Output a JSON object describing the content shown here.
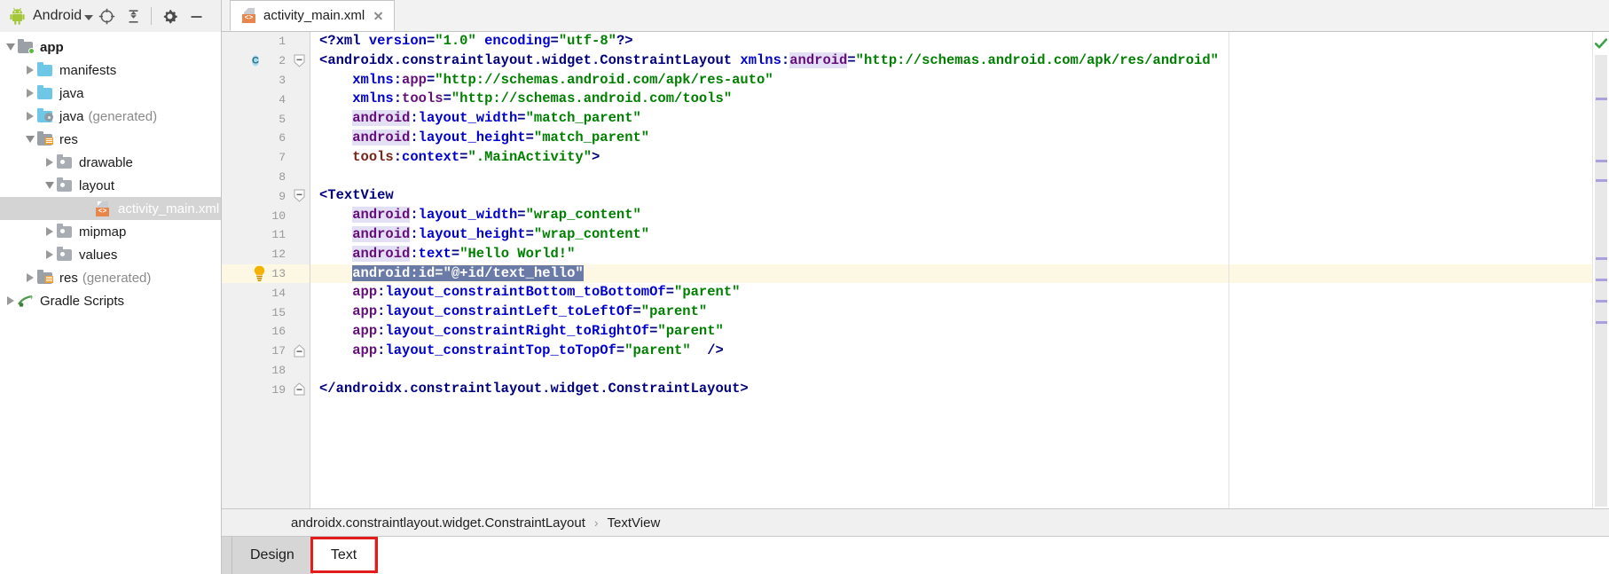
{
  "window": {
    "project_panel_title": "Android",
    "toolbar_icons": [
      "android-logo",
      "dropdown-caret",
      "locate-target-icon",
      "collapse-all-icon",
      "settings-gear-icon",
      "minimize-icon"
    ]
  },
  "editor_tab": {
    "filename": "activity_main.xml",
    "icon": "xml-file-icon",
    "badge_text": "<>",
    "close_icon": "close-icon"
  },
  "project_tree": [
    {
      "label": "app",
      "suffix": "",
      "indent": 0,
      "expanded": true,
      "icon": "module-folder",
      "bold": true,
      "selected": false
    },
    {
      "label": "manifests",
      "suffix": "",
      "indent": 1,
      "expanded": false,
      "icon": "blue-folder",
      "bold": false,
      "selected": false
    },
    {
      "label": "java",
      "suffix": "",
      "indent": 1,
      "expanded": false,
      "icon": "blue-folder",
      "bold": false,
      "selected": false
    },
    {
      "label": "java",
      "suffix": "(generated)",
      "indent": 1,
      "expanded": false,
      "icon": "generated-folder",
      "bold": false,
      "selected": false
    },
    {
      "label": "res",
      "suffix": "",
      "indent": 1,
      "expanded": true,
      "icon": "res-folder",
      "bold": false,
      "selected": false
    },
    {
      "label": "drawable",
      "suffix": "",
      "indent": 2,
      "expanded": false,
      "icon": "gray-folder",
      "bold": false,
      "selected": false
    },
    {
      "label": "layout",
      "suffix": "",
      "indent": 2,
      "expanded": true,
      "icon": "gray-folder",
      "bold": false,
      "selected": false
    },
    {
      "label": "activity_main.xml",
      "suffix": "",
      "indent": 4,
      "expanded": null,
      "icon": "xml-file",
      "bold": false,
      "selected": true
    },
    {
      "label": "mipmap",
      "suffix": "",
      "indent": 2,
      "expanded": false,
      "icon": "gray-folder",
      "bold": false,
      "selected": false
    },
    {
      "label": "values",
      "suffix": "",
      "indent": 2,
      "expanded": false,
      "icon": "gray-folder",
      "bold": false,
      "selected": false
    },
    {
      "label": "res",
      "suffix": "(generated)",
      "indent": 1,
      "expanded": false,
      "icon": "res-gen-folder",
      "bold": false,
      "selected": false
    },
    {
      "label": "Gradle Scripts",
      "suffix": "",
      "indent": 0,
      "expanded": false,
      "icon": "gradle-icon",
      "bold": false,
      "selected": false
    }
  ],
  "code": {
    "lines": [
      {
        "n": "1",
        "gutter_anno": "",
        "fold": "",
        "current": false,
        "tokens": [
          {
            "c": "t-punc",
            "t": "<?"
          },
          {
            "c": "t-tag",
            "t": "xml"
          },
          {
            "c": "t-plain",
            "t": " "
          },
          {
            "c": "t-attr",
            "t": "version"
          },
          {
            "c": "t-eq",
            "t": "="
          },
          {
            "c": "t-val",
            "t": "\"1.0\""
          },
          {
            "c": "t-plain",
            "t": " "
          },
          {
            "c": "t-attr",
            "t": "encoding"
          },
          {
            "c": "t-eq",
            "t": "="
          },
          {
            "c": "t-val",
            "t": "\"utf-8\""
          },
          {
            "c": "t-punc",
            "t": "?>"
          }
        ]
      },
      {
        "n": "2",
        "gutter_anno": "c-badge",
        "fold": "minus",
        "current": false,
        "tokens": [
          {
            "c": "t-punc",
            "t": "<"
          },
          {
            "c": "t-tag",
            "t": "androidx.constraintlayout.widget.ConstraintLayout"
          },
          {
            "c": "t-plain",
            "t": " "
          },
          {
            "c": "t-attr",
            "t": "xmlns"
          },
          {
            "c": "t-eq",
            "t": ":"
          },
          {
            "c": "t-ns-hl",
            "t": "android"
          },
          {
            "c": "t-eq",
            "t": "="
          },
          {
            "c": "t-val",
            "t": "\"http://schemas.android.com/apk/res/android\""
          }
        ]
      },
      {
        "n": "3",
        "gutter_anno": "",
        "fold": "",
        "current": false,
        "tokens": [
          {
            "c": "t-plain",
            "t": "    "
          },
          {
            "c": "t-attr",
            "t": "xmlns"
          },
          {
            "c": "t-eq",
            "t": ":"
          },
          {
            "c": "t-ns",
            "t": "app"
          },
          {
            "c": "t-eq",
            "t": "="
          },
          {
            "c": "t-val",
            "t": "\"http://schemas.android.com/apk/res-auto\""
          }
        ]
      },
      {
        "n": "4",
        "gutter_anno": "",
        "fold": "",
        "current": false,
        "tokens": [
          {
            "c": "t-plain",
            "t": "    "
          },
          {
            "c": "t-attr",
            "t": "xmlns"
          },
          {
            "c": "t-eq",
            "t": ":"
          },
          {
            "c": "t-ns",
            "t": "tools"
          },
          {
            "c": "t-eq",
            "t": "="
          },
          {
            "c": "t-val",
            "t": "\"http://schemas.android.com/tools\""
          }
        ]
      },
      {
        "n": "5",
        "gutter_anno": "",
        "fold": "",
        "current": false,
        "tokens": [
          {
            "c": "t-plain",
            "t": "    "
          },
          {
            "c": "t-ns-hl",
            "t": "android"
          },
          {
            "c": "t-eq",
            "t": ":"
          },
          {
            "c": "t-attr",
            "t": "layout_width"
          },
          {
            "c": "t-eq",
            "t": "="
          },
          {
            "c": "t-val",
            "t": "\"match_parent\""
          }
        ]
      },
      {
        "n": "6",
        "gutter_anno": "",
        "fold": "",
        "current": false,
        "tokens": [
          {
            "c": "t-plain",
            "t": "    "
          },
          {
            "c": "t-ns-hl",
            "t": "android"
          },
          {
            "c": "t-eq",
            "t": ":"
          },
          {
            "c": "t-attr",
            "t": "layout_height"
          },
          {
            "c": "t-eq",
            "t": "="
          },
          {
            "c": "t-val",
            "t": "\"match_parent\""
          }
        ]
      },
      {
        "n": "7",
        "gutter_anno": "",
        "fold": "",
        "current": false,
        "tokens": [
          {
            "c": "t-plain",
            "t": "    "
          },
          {
            "c": "t-tools",
            "t": "tools"
          },
          {
            "c": "t-eq",
            "t": ":"
          },
          {
            "c": "t-attr",
            "t": "context"
          },
          {
            "c": "t-eq",
            "t": "="
          },
          {
            "c": "t-val",
            "t": "\".MainActivity\""
          },
          {
            "c": "t-punc",
            "t": ">"
          }
        ]
      },
      {
        "n": "8",
        "gutter_anno": "",
        "fold": "",
        "current": false,
        "tokens": []
      },
      {
        "n": "9",
        "gutter_anno": "",
        "fold": "minus",
        "current": false,
        "tokens": [
          {
            "c": "t-punc",
            "t": "<"
          },
          {
            "c": "t-tag",
            "t": "TextView"
          }
        ]
      },
      {
        "n": "10",
        "gutter_anno": "",
        "fold": "",
        "current": false,
        "tokens": [
          {
            "c": "t-plain",
            "t": "    "
          },
          {
            "c": "t-ns-hl",
            "t": "android"
          },
          {
            "c": "t-eq",
            "t": ":"
          },
          {
            "c": "t-attr",
            "t": "layout_width"
          },
          {
            "c": "t-eq",
            "t": "="
          },
          {
            "c": "t-val",
            "t": "\"wrap_content\""
          }
        ]
      },
      {
        "n": "11",
        "gutter_anno": "",
        "fold": "",
        "current": false,
        "tokens": [
          {
            "c": "t-plain",
            "t": "    "
          },
          {
            "c": "t-ns-hl",
            "t": "android"
          },
          {
            "c": "t-eq",
            "t": ":"
          },
          {
            "c": "t-attr",
            "t": "layout_height"
          },
          {
            "c": "t-eq",
            "t": "="
          },
          {
            "c": "t-val",
            "t": "\"wrap_content\""
          }
        ]
      },
      {
        "n": "12",
        "gutter_anno": "",
        "fold": "",
        "current": false,
        "tokens": [
          {
            "c": "t-plain",
            "t": "    "
          },
          {
            "c": "t-ns-hl",
            "t": "android"
          },
          {
            "c": "t-eq",
            "t": ":"
          },
          {
            "c": "t-attr",
            "t": "text"
          },
          {
            "c": "t-eq",
            "t": "="
          },
          {
            "c": "t-val",
            "t": "\"Hello World!\""
          }
        ]
      },
      {
        "n": "13",
        "gutter_anno": "lightbulb",
        "fold": "",
        "current": true,
        "selected_from": 1,
        "tokens": [
          {
            "c": "t-plain",
            "t": "    "
          },
          {
            "c": "t-ns",
            "t": "android"
          },
          {
            "c": "t-eq",
            "t": ":"
          },
          {
            "c": "t-attr",
            "t": "id"
          },
          {
            "c": "t-eq",
            "t": "="
          },
          {
            "c": "t-val",
            "t": "\"@+id/text_hello\""
          }
        ]
      },
      {
        "n": "14",
        "gutter_anno": "",
        "fold": "",
        "current": false,
        "tokens": [
          {
            "c": "t-plain",
            "t": "    "
          },
          {
            "c": "t-ns",
            "t": "app"
          },
          {
            "c": "t-eq",
            "t": ":"
          },
          {
            "c": "t-attr",
            "t": "layout_constraintBottom_toBottomOf"
          },
          {
            "c": "t-eq",
            "t": "="
          },
          {
            "c": "t-val",
            "t": "\"parent\""
          }
        ]
      },
      {
        "n": "15",
        "gutter_anno": "",
        "fold": "",
        "current": false,
        "tokens": [
          {
            "c": "t-plain",
            "t": "    "
          },
          {
            "c": "t-ns",
            "t": "app"
          },
          {
            "c": "t-eq",
            "t": ":"
          },
          {
            "c": "t-attr",
            "t": "layout_constraintLeft_toLeftOf"
          },
          {
            "c": "t-eq",
            "t": "="
          },
          {
            "c": "t-val",
            "t": "\"parent\""
          }
        ]
      },
      {
        "n": "16",
        "gutter_anno": "",
        "fold": "",
        "current": false,
        "tokens": [
          {
            "c": "t-plain",
            "t": "    "
          },
          {
            "c": "t-ns",
            "t": "app"
          },
          {
            "c": "t-eq",
            "t": ":"
          },
          {
            "c": "t-attr",
            "t": "layout_constraintRight_toRightOf"
          },
          {
            "c": "t-eq",
            "t": "="
          },
          {
            "c": "t-val",
            "t": "\"parent\""
          }
        ]
      },
      {
        "n": "17",
        "gutter_anno": "",
        "fold": "plus",
        "current": false,
        "tokens": [
          {
            "c": "t-plain",
            "t": "    "
          },
          {
            "c": "t-ns",
            "t": "app"
          },
          {
            "c": "t-eq",
            "t": ":"
          },
          {
            "c": "t-attr",
            "t": "layout_constraintTop_toTopOf"
          },
          {
            "c": "t-eq",
            "t": "="
          },
          {
            "c": "t-val",
            "t": "\"parent\""
          },
          {
            "c": "t-plain",
            "t": "  "
          },
          {
            "c": "t-punc",
            "t": "/>"
          }
        ]
      },
      {
        "n": "18",
        "gutter_anno": "",
        "fold": "",
        "current": false,
        "tokens": []
      },
      {
        "n": "19",
        "gutter_anno": "",
        "fold": "plus",
        "current": false,
        "tokens": [
          {
            "c": "t-punc",
            "t": "</"
          },
          {
            "c": "t-tag",
            "t": "androidx.constraintlayout.widget.ConstraintLayout"
          },
          {
            "c": "t-punc",
            "t": ">"
          }
        ]
      }
    ]
  },
  "markers": {
    "status_icon": "green-check-icon",
    "positions": [
      48,
      118,
      140,
      228,
      252,
      276,
      300
    ]
  },
  "breadcrumb": {
    "root": "androidx.constraintlayout.widget.ConstraintLayout",
    "separator": "›",
    "leaf": "TextView"
  },
  "bottom_tabs": [
    {
      "label": "Design",
      "active": false
    },
    {
      "label": "Text",
      "active": true
    }
  ],
  "annotation": {
    "shape": "rectangle",
    "color": "#e31b1b",
    "around": "Text"
  },
  "colors": {
    "selection_blue": "#6b7ba8",
    "current_line": "#fdf8e3",
    "tree_selection": "#d4d4d4",
    "accent_orange": "#e8854a",
    "marker_purple": "#a9a0dd",
    "annotation_red": "#e31b1b"
  }
}
